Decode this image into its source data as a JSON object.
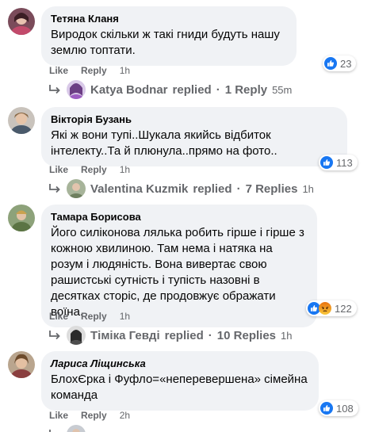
{
  "labels": {
    "like": "Like",
    "reply": "Reply",
    "replied": "replied",
    "separator": "·"
  },
  "colors": {
    "like_blue": "#1877f2",
    "bubble": "#f0f2f5",
    "secondary_text": "#65676b"
  },
  "comments": [
    {
      "author": "Тетяна Кланя",
      "text": "Виродок скільки ж такі гниди будуть нашу землю топтати.",
      "time": "1h",
      "reactions": {
        "icons": [
          "like-icon"
        ],
        "count": "23"
      },
      "replies": {
        "name": "Katya Bodnar",
        "count": "1 Reply",
        "time": "55m"
      }
    },
    {
      "author": "Вікторія Бузань",
      "text": "Які ж вони тупі..Шукала якийсь відбиток інтелекту..Та й плюнула..прямо на фото..",
      "time": "1h",
      "reactions": {
        "icons": [
          "like-icon"
        ],
        "count": "113"
      },
      "replies": {
        "name": "Valentina Kuzmik",
        "count": "7 Replies",
        "time": "1h"
      }
    },
    {
      "author": "Тамара Борисова",
      "text": "Його силіконова лялька робить гірше і гірше з кожною хвилиною. Там нема і натяка на розум і людяність. Вона вивертає свою рашистські сутність і тупість назовні в десятках сторіс, де продовжує ображати воїна.",
      "time": "1h",
      "reactions": {
        "icons": [
          "like-icon",
          "angry-icon"
        ],
        "count": "122"
      },
      "replies": {
        "name": "Тіміка Гевді",
        "count": "10 Replies",
        "time": "1h"
      }
    },
    {
      "author": "Лариса Ліщинська",
      "text": "БлохЄрка і Фуфло=«неперевершена» сімейна команда",
      "time": "2h",
      "reactions": {
        "icons": [
          "like-icon"
        ],
        "count": "108"
      },
      "replies": {
        "name": "",
        "count": "",
        "time": ""
      }
    }
  ]
}
